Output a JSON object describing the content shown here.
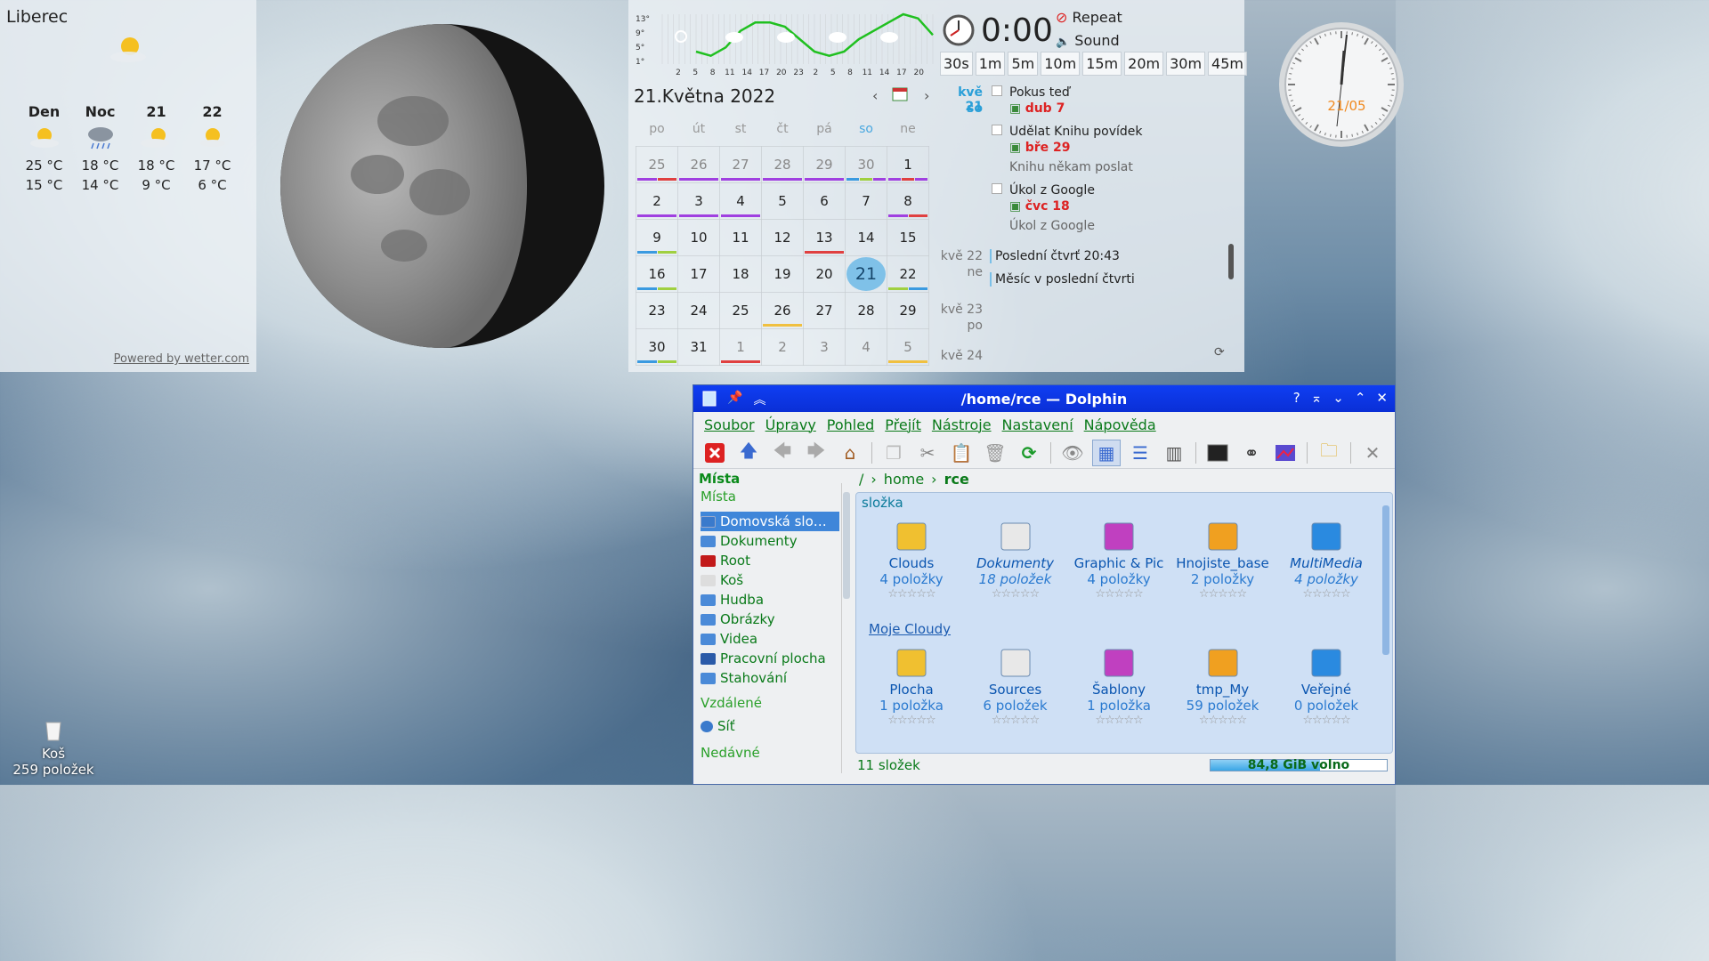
{
  "weather": {
    "city": "Liberec",
    "current_icon": "partly-sunny-icon",
    "days": [
      {
        "label": "Den",
        "icon": "partly-sunny-icon",
        "high": "25 °C",
        "low": "15 °C"
      },
      {
        "label": "Noc",
        "icon": "rain-cloud-icon",
        "high": "18 °C",
        "low": "14 °C"
      },
      {
        "label": "21",
        "icon": "partly-sunny-icon",
        "high": "18 °C",
        "low": "9 °C"
      },
      {
        "label": "22",
        "icon": "partly-sunny-icon",
        "high": "17 °C",
        "low": "6 °C"
      }
    ],
    "powered_by": "Powered by wetter.com"
  },
  "forecast_graph": {
    "y_ticks": [
      "13°",
      "9°",
      "5°",
      "1°"
    ],
    "x_ticks": [
      "2",
      "5",
      "8",
      "11",
      "14",
      "17",
      "20",
      "23",
      "2",
      "5",
      "8",
      "11",
      "14",
      "17",
      "20"
    ],
    "temps": [
      4,
      3,
      5,
      9,
      11,
      11,
      10,
      7,
      4,
      3,
      4,
      7,
      9,
      11,
      13,
      12,
      8
    ],
    "line_color": "#20c020"
  },
  "timer": {
    "time": "0:00",
    "repeat_label": "Repeat",
    "sound_label": "Sound",
    "presets": [
      "30s",
      "1m",
      "5m",
      "10m",
      "15m",
      "20m",
      "30m",
      "45m"
    ]
  },
  "calendar": {
    "title": "21.Května 2022",
    "weekdays": [
      "po",
      "út",
      "st",
      "čt",
      "pá",
      "so",
      "ne"
    ],
    "weeks": [
      [
        {
          "d": "25",
          "dim": true,
          "ul": [
            "#a040e0",
            "#e04040"
          ]
        },
        {
          "d": "26",
          "dim": true,
          "ul": [
            "#a040e0"
          ]
        },
        {
          "d": "27",
          "dim": true,
          "ul": [
            "#a040e0"
          ]
        },
        {
          "d": "28",
          "dim": true,
          "ul": [
            "#a040e0"
          ]
        },
        {
          "d": "29",
          "dim": true,
          "ul": [
            "#a040e0"
          ]
        },
        {
          "d": "30",
          "dim": true,
          "ul": [
            "#3a9ae0",
            "#a0d040",
            "#a040e0"
          ]
        },
        {
          "d": "1",
          "ul": [
            "#a040e0",
            "#e04040",
            "#a040e0"
          ]
        }
      ],
      [
        {
          "d": "2",
          "ul": [
            "#a040e0"
          ]
        },
        {
          "d": "3",
          "ul": [
            "#a040e0"
          ]
        },
        {
          "d": "4",
          "ul": [
            "#a040e0"
          ]
        },
        {
          "d": "5"
        },
        {
          "d": "6"
        },
        {
          "d": "7"
        },
        {
          "d": "8",
          "ul": [
            "#a040e0",
            "#e04040"
          ]
        }
      ],
      [
        {
          "d": "9",
          "ul": [
            "#3a9ae0",
            "#a0d040"
          ]
        },
        {
          "d": "10"
        },
        {
          "d": "11"
        },
        {
          "d": "12"
        },
        {
          "d": "13",
          "ul": [
            "#e04040"
          ]
        },
        {
          "d": "14"
        },
        {
          "d": "15"
        }
      ],
      [
        {
          "d": "16",
          "ul": [
            "#3a9ae0",
            "#a0d040"
          ]
        },
        {
          "d": "17"
        },
        {
          "d": "18"
        },
        {
          "d": "19"
        },
        {
          "d": "20"
        },
        {
          "d": "21",
          "today": true
        },
        {
          "d": "22",
          "ul": [
            "#a0d040",
            "#3a9ae0"
          ]
        }
      ],
      [
        {
          "d": "23"
        },
        {
          "d": "24"
        },
        {
          "d": "25"
        },
        {
          "d": "26",
          "ul": [
            "#f0c040"
          ]
        },
        {
          "d": "27"
        },
        {
          "d": "28"
        },
        {
          "d": "29"
        }
      ],
      [
        {
          "d": "30",
          "ul": [
            "#3a9ae0",
            "#a0d040"
          ]
        },
        {
          "d": "31"
        },
        {
          "d": "1",
          "dim": true,
          "ul": [
            "#e04040"
          ]
        },
        {
          "d": "2",
          "dim": true
        },
        {
          "d": "3",
          "dim": true
        },
        {
          "d": "4",
          "dim": true
        },
        {
          "d": "5",
          "dim": true,
          "ul": [
            "#f0c040"
          ]
        }
      ]
    ]
  },
  "agenda": {
    "date1": "kvě 21",
    "date1_day": "so",
    "tasks": [
      {
        "title": "Pokus teď",
        "due": "dub 7",
        "note": ""
      },
      {
        "title": "Udělat Knihu povídek",
        "due": "bře 29",
        "note": "Knihu někam poslat"
      },
      {
        "title": "Úkol z Google",
        "due": "čvc 18",
        "note": "Úkol z Google"
      }
    ],
    "date2": "kvě 22",
    "date2_day": "ne",
    "event1": "Poslední čtvrť 20:43",
    "event2": "Měsíc v poslední čtvrti",
    "date3": "kvě 23",
    "date3_day": "po",
    "date4": "kvě 24"
  },
  "clock": {
    "date": "21/05"
  },
  "dolphin": {
    "title": "/home/rce — Dolphin",
    "menu": [
      "Soubor",
      "Úpravy",
      "Pohled",
      "Přejít",
      "Nástroje",
      "Nastavení",
      "Nápověda"
    ],
    "places_header": "Místa",
    "places_section": "Místa",
    "places": [
      "Domovská slo…",
      "Dokumenty",
      "Root",
      "Koš",
      "Hudba",
      "Obrázky",
      "Videa",
      "Pracovní plocha",
      "Stahování"
    ],
    "remote_section": "Vzdálené",
    "remote_items": [
      "Síť"
    ],
    "recent_section": "Nedávné",
    "breadcrumb": [
      "/",
      "home",
      "rce"
    ],
    "group1": "složka",
    "group2": "Moje Cloudy",
    "items_row1": [
      {
        "name": "Clouds",
        "count": "4 položky",
        "icon": "cloud-folder-icon",
        "italic": false
      },
      {
        "name": "Dokumenty",
        "count": "18 položek",
        "icon": "documents-folder-icon",
        "italic": true
      },
      {
        "name": "Graphic & Pic",
        "count": "4 položky",
        "icon": "graphics-folder-icon",
        "italic": false
      },
      {
        "name": "Hnojiste_base",
        "count": "2 položky",
        "icon": "archive-folder-icon",
        "italic": false
      },
      {
        "name": "MultiMedia",
        "count": "4 položky",
        "icon": "multimedia-folder-icon",
        "italic": true
      }
    ],
    "items_row2": [
      {
        "name": "Plocha",
        "count": "1 položka",
        "icon": "desktop-folder-icon",
        "italic": false
      },
      {
        "name": "Sources",
        "count": "6 položek",
        "icon": "sources-folder-icon",
        "italic": false
      },
      {
        "name": "Šablony",
        "count": "1 položka",
        "icon": "templates-folder-icon",
        "italic": false
      },
      {
        "name": "tmp_My",
        "count": "59 položek",
        "icon": "tmp-folder-icon",
        "italic": false
      },
      {
        "name": "Veřejné",
        "count": "0 položek",
        "icon": "public-folder-icon",
        "italic": false
      }
    ],
    "status": "11 složek",
    "free_space": "84,8 GiB volno",
    "free_fraction": 0.62
  },
  "desktop": {
    "trash_label": "Koš",
    "trash_count": "259 položek"
  }
}
